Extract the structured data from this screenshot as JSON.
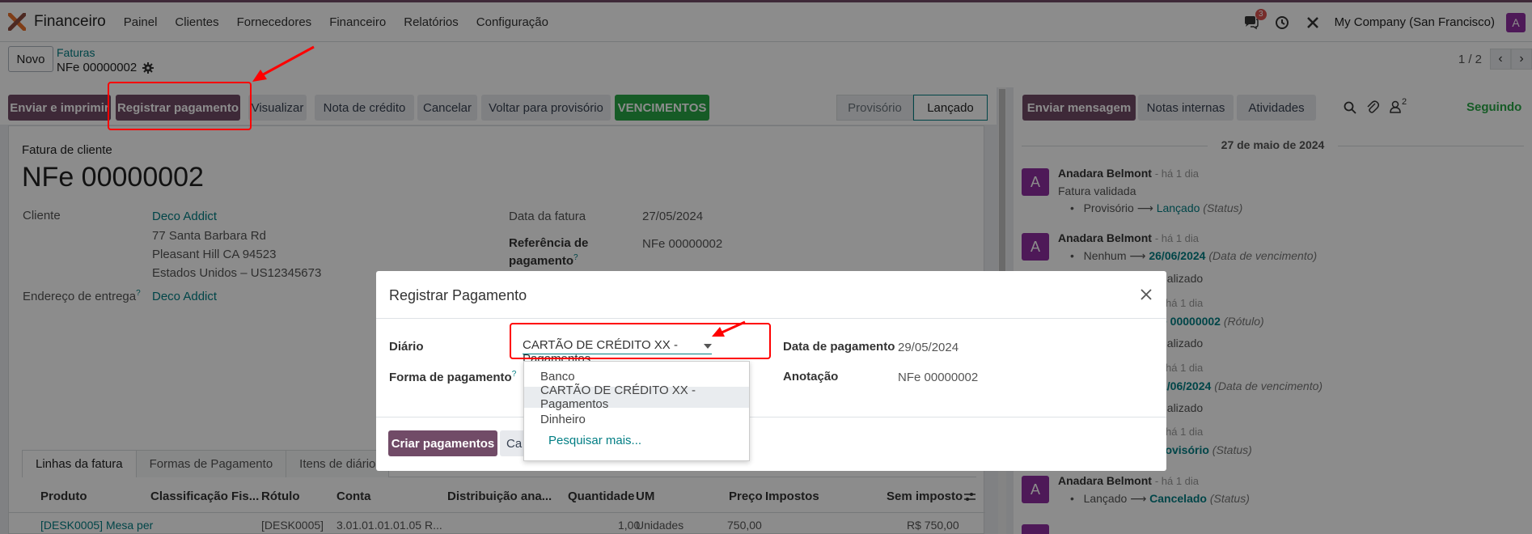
{
  "nav": {
    "app_name": "Financeiro",
    "menu": [
      "Painel",
      "Clientes",
      "Fornecedores",
      "Financeiro",
      "Relatórios",
      "Configuração"
    ],
    "chat_badge": "3",
    "company": "My Company (San Francisco)",
    "user_initial": "A"
  },
  "control": {
    "new_label": "Novo",
    "breadcrumb_parent": "Faturas",
    "breadcrumb_current": "NFe 00000002",
    "pager": "1 / 2"
  },
  "actions": {
    "send_print": "Enviar e imprimir",
    "register_payment": "Registrar pagamento",
    "preview": "Visualizar",
    "credit_note": "Nota de crédito",
    "cancel": "Cancelar",
    "reset_draft": "Voltar para provisório",
    "due_dates": "VENCIMENTOS"
  },
  "status": {
    "draft": "Provisório",
    "posted": "Lançado"
  },
  "invoice": {
    "type": "Fatura de cliente",
    "number": "NFe 00000002",
    "customer_label": "Cliente",
    "customer_name": "Deco Addict",
    "address_1": "77 Santa Barbara Rd",
    "address_2": "Pleasant Hill CA 94523",
    "address_3": "Estados Unidos – US12345673",
    "delivery_label": "Endereço de entrega",
    "delivery_help": "?",
    "delivery_value": "Deco Addict",
    "date_label": "Data da fatura",
    "date_value": "27/05/2024",
    "ref_label_1": "Referência de",
    "ref_label_2": "pagamento",
    "ref_help": "?",
    "ref_value": "NFe 00000002"
  },
  "tabs": [
    "Linhas da fatura",
    "Formas de Pagamento",
    "Itens de diário"
  ],
  "table": {
    "headers": [
      "Produto",
      "Classificação Fis...",
      "Rótulo",
      "Conta",
      "Distribuição ana...",
      "Quantidade",
      "UM",
      "Preço",
      "Impostos",
      "Sem imposto"
    ],
    "row": [
      "[DESK0005] Mesa per",
      "",
      "[DESK0005]",
      "3.01.01.01.01.05 R...",
      "",
      "1,00",
      "Unidades",
      "750,00",
      "",
      "R$ 750,00"
    ]
  },
  "chatter": {
    "send_message": "Enviar mensagem",
    "log_note": "Notas internas",
    "activities": "Atividades",
    "followers_count": "2",
    "following": "Seguindo",
    "date_separator": "27 de maio de 2024",
    "messages": [
      {
        "author": "Anadara Belmont",
        "time": "- há 1 dia",
        "body": "Fatura validada",
        "from": "Provisório",
        "arrow": "⟶",
        "to": "Lançado",
        "field": "(Status)"
      },
      {
        "author": "Anadara Belmont",
        "time": "- há 1 dia",
        "from": "Nenhum",
        "arrow": "⟶",
        "to": "26/06/2024",
        "field": "(Data de vencimento)",
        "extra": "ualizado"
      },
      {
        "time": "há 1 dia",
        "to": "e 00000002",
        "field": "(Rótulo)",
        "extra": "ualizado"
      },
      {
        "time": "há 1 dia",
        "to": "1/06/2024",
        "field": "(Data de vencimento)",
        "extra": "ualizado"
      },
      {
        "time": "há 1 dia",
        "to": "rovisório",
        "field": "(Status)"
      },
      {
        "author": "Anadara Belmont",
        "time": "- há 1 dia",
        "from": "Lançado",
        "arrow": "⟶",
        "to": "Cancelado",
        "field": "(Status)"
      }
    ]
  },
  "modal": {
    "title": "Registrar Pagamento",
    "journal_label": "Diário",
    "journal_value": "CARTÃO DE CRÉDITO XX - Pagamentos",
    "method_label": "Forma de pagamento",
    "method_help": "?",
    "date_label": "Data de pagamento",
    "date_value": "29/05/2024",
    "memo_label": "Anotação",
    "memo_value": "NFe 00000002",
    "create_btn": "Criar pagamentos",
    "cancel_btn_partial": "Ca",
    "options": [
      "Banco",
      "CARTÃO DE CRÉDITO XX - Pagamentos",
      "Dinheiro"
    ],
    "search_more": "Pesquisar mais..."
  },
  "colors": {
    "primary": "#714b67",
    "link": "#017e84",
    "green": "#28a745",
    "annotation": "#ff0000"
  }
}
